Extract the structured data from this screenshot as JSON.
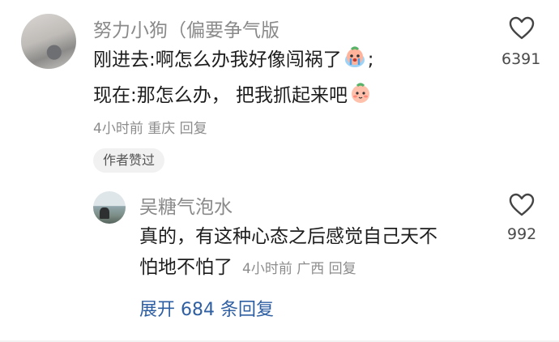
{
  "comment": {
    "username": "努力小狗（偏要争气版",
    "line1_text": "刚进去:啊怎么办我好像闯祸了",
    "line1_suffix": ";",
    "line2_text": "现在:那怎么办，  把我抓起来吧",
    "meta": "4小时前  重庆  回复",
    "badge": "作者赞过",
    "like_count": "6391",
    "emoji1": "crying-peach-emoji",
    "emoji2": "smiling-peach-emoji"
  },
  "reply": {
    "username": "吴糖气泡水",
    "line1_text": "真的，有这种心态之后感觉自己天不",
    "line2_text": "怕地不怕了",
    "meta": "4小时前  广西  回复",
    "like_count": "992"
  },
  "expand_label": "展开 684 条回复",
  "colors": {
    "link": "#2f5fa3",
    "muted": "#8c8c8c",
    "text": "#1d1d1d"
  }
}
